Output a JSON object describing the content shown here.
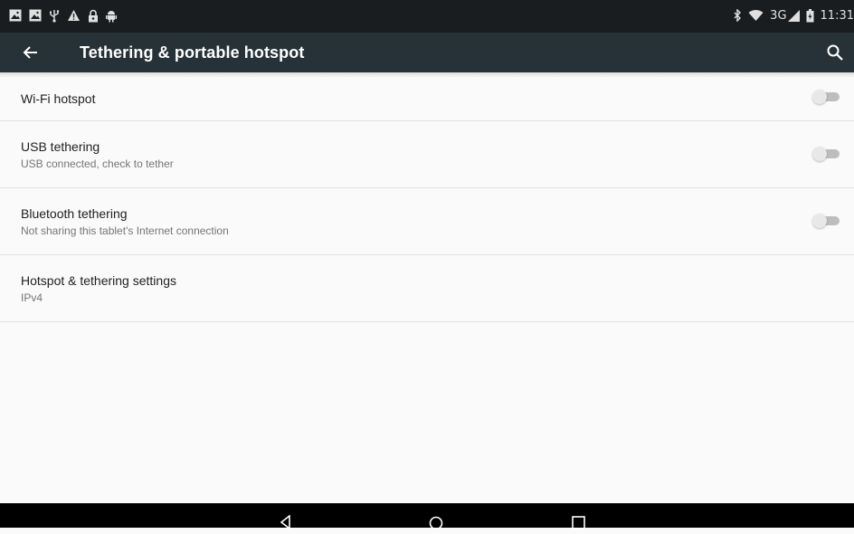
{
  "status_bar": {
    "network_type": "3G",
    "time": "11:31",
    "left_icons": [
      "image-notification-icon",
      "image-notification-icon",
      "usb-icon",
      "warning-icon",
      "lock-icon",
      "android-debug-icon"
    ],
    "right_icons": [
      "bluetooth-icon",
      "wifi-icon",
      "cell-signal-icon",
      "battery-icon"
    ]
  },
  "app_bar": {
    "title": "Tethering & portable hotspot",
    "back_icon": "arrow-back-icon",
    "search_icon": "search-icon",
    "color": "#263238"
  },
  "settings": [
    {
      "title": "Wi-Fi hotspot",
      "subtitle": "",
      "toggle_on": false
    },
    {
      "title": "USB tethering",
      "subtitle": "USB connected, check to tether",
      "toggle_on": false
    },
    {
      "title": "Bluetooth tethering",
      "subtitle": "Not sharing this tablet's Internet connection",
      "toggle_on": false
    },
    {
      "title": "Hotspot & tethering settings",
      "subtitle": "IPv4"
    }
  ],
  "nav_bar": {
    "buttons": [
      "back-triangle-icon",
      "home-circle-icon",
      "recents-square-icon"
    ]
  }
}
